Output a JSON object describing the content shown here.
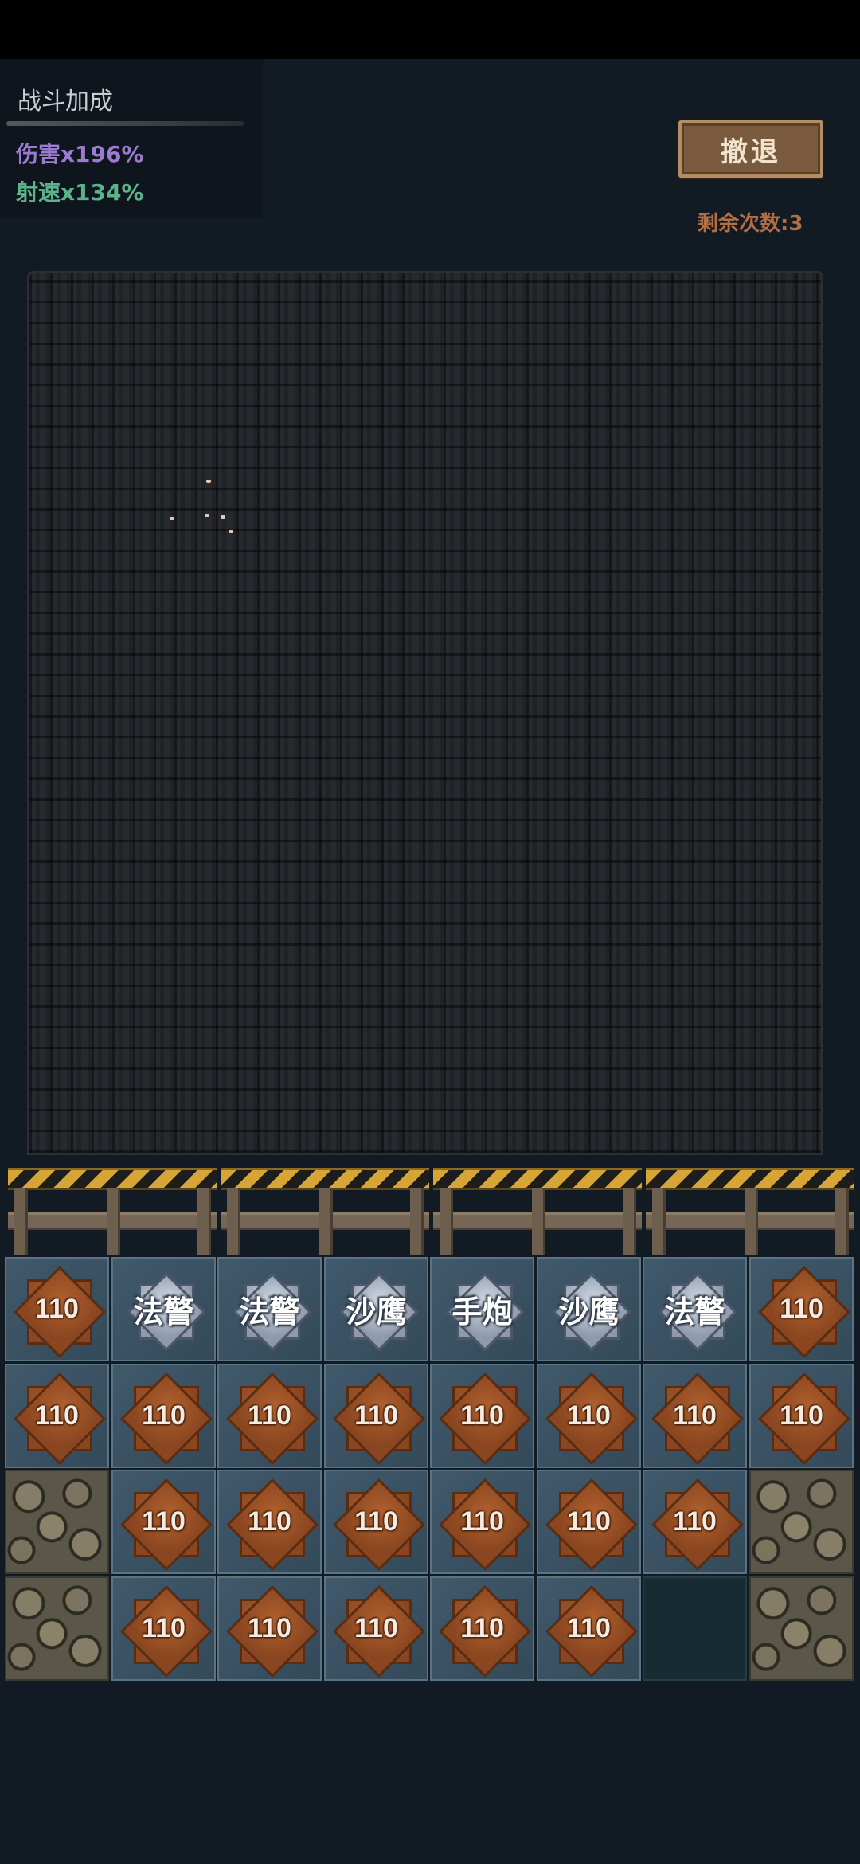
{
  "hud": {
    "panel_title": "战斗加成",
    "damage": "伤害x196%",
    "fire_rate": "射速x134%",
    "retreat_label": "撤退",
    "remaining": "剩余次数:3"
  },
  "colors": {
    "damage": "#9b7bd1",
    "fire_rate": "#5cb38a",
    "remaining": "#b46e46",
    "button": "#7a5a3e"
  },
  "board": {
    "rows": [
      [
        {
          "t": "bronze",
          "label": "110"
        },
        {
          "t": "silver",
          "label": "法警"
        },
        {
          "t": "silver",
          "label": "法警"
        },
        {
          "t": "silver",
          "label": "沙鹰"
        },
        {
          "t": "silver",
          "label": "手炮"
        },
        {
          "t": "silver",
          "label": "沙鹰"
        },
        {
          "t": "silver",
          "label": "法警"
        },
        {
          "t": "bronze",
          "label": "110"
        }
      ],
      [
        {
          "t": "bronze",
          "label": "110"
        },
        {
          "t": "bronze",
          "label": "110"
        },
        {
          "t": "bronze",
          "label": "110"
        },
        {
          "t": "bronze",
          "label": "110"
        },
        {
          "t": "bronze",
          "label": "110"
        },
        {
          "t": "bronze",
          "label": "110"
        },
        {
          "t": "bronze",
          "label": "110"
        },
        {
          "t": "bronze",
          "label": "110"
        }
      ],
      [
        {
          "t": "rock"
        },
        {
          "t": "bronze",
          "label": "110"
        },
        {
          "t": "bronze",
          "label": "110"
        },
        {
          "t": "bronze",
          "label": "110"
        },
        {
          "t": "bronze",
          "label": "110"
        },
        {
          "t": "bronze",
          "label": "110"
        },
        {
          "t": "bronze",
          "label": "110"
        },
        {
          "t": "rock"
        }
      ],
      [
        {
          "t": "rock"
        },
        {
          "t": "bronze",
          "label": "110"
        },
        {
          "t": "bronze",
          "label": "110"
        },
        {
          "t": "bronze",
          "label": "110"
        },
        {
          "t": "bronze",
          "label": "110"
        },
        {
          "t": "bronze",
          "label": "110"
        },
        {
          "t": "empty"
        },
        {
          "t": "rock"
        }
      ]
    ]
  }
}
